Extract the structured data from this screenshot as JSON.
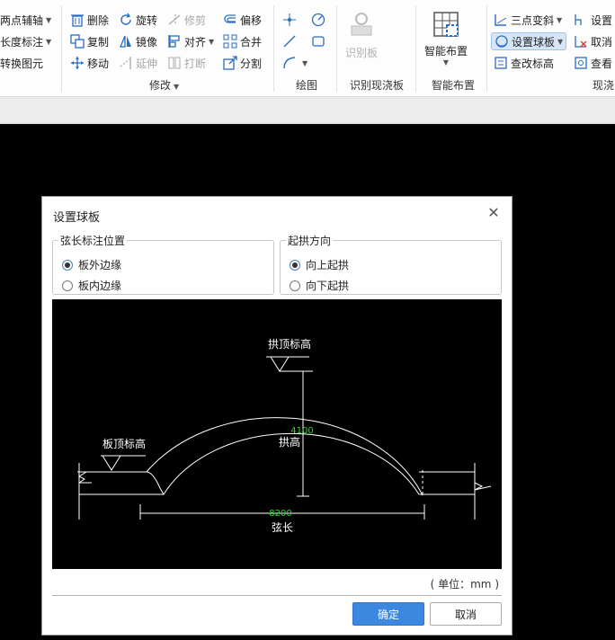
{
  "ribbon": {
    "col0": [
      "两点辅轴",
      "长度标注",
      "转换图元"
    ],
    "modify": {
      "row1": [
        "删除",
        "旋转",
        "修剪",
        "偏移"
      ],
      "row2": [
        "复制",
        "镜像",
        "对齐",
        "合并"
      ],
      "row3": [
        "移动",
        "延伸",
        "打断",
        "分割"
      ],
      "label": "修改"
    },
    "draw_label": "绘图",
    "identify": {
      "button": "识别板",
      "label": "识别现浇板"
    },
    "smart": {
      "button": "智能布置",
      "label": "智能布置"
    },
    "slab": {
      "col1": [
        "三点变斜",
        "设置球板",
        "查改标高"
      ],
      "col2": [
        "设置",
        "取消",
        "查看"
      ],
      "label": "现浇"
    }
  },
  "dialog": {
    "title": "设置球板",
    "chord_group": {
      "legend": "弦长标注位置",
      "options": [
        "板外边缘",
        "板内边缘"
      ],
      "selected": 0
    },
    "arch_group": {
      "legend": "起拱方向",
      "options": [
        "向上起拱",
        "向下起拱"
      ],
      "selected": 0
    },
    "diagram": {
      "top_label": "拱顶标高",
      "edge_label": "板顶标高",
      "height_value": "4100",
      "height_label": "拱高",
      "chord_value": "8200",
      "chord_label": "弦长"
    },
    "unit": "( 单位：mm )",
    "ok": "确定",
    "cancel": "取消"
  },
  "colors": {
    "accent": "#3c87e0",
    "dim_value": "#22dd22"
  }
}
